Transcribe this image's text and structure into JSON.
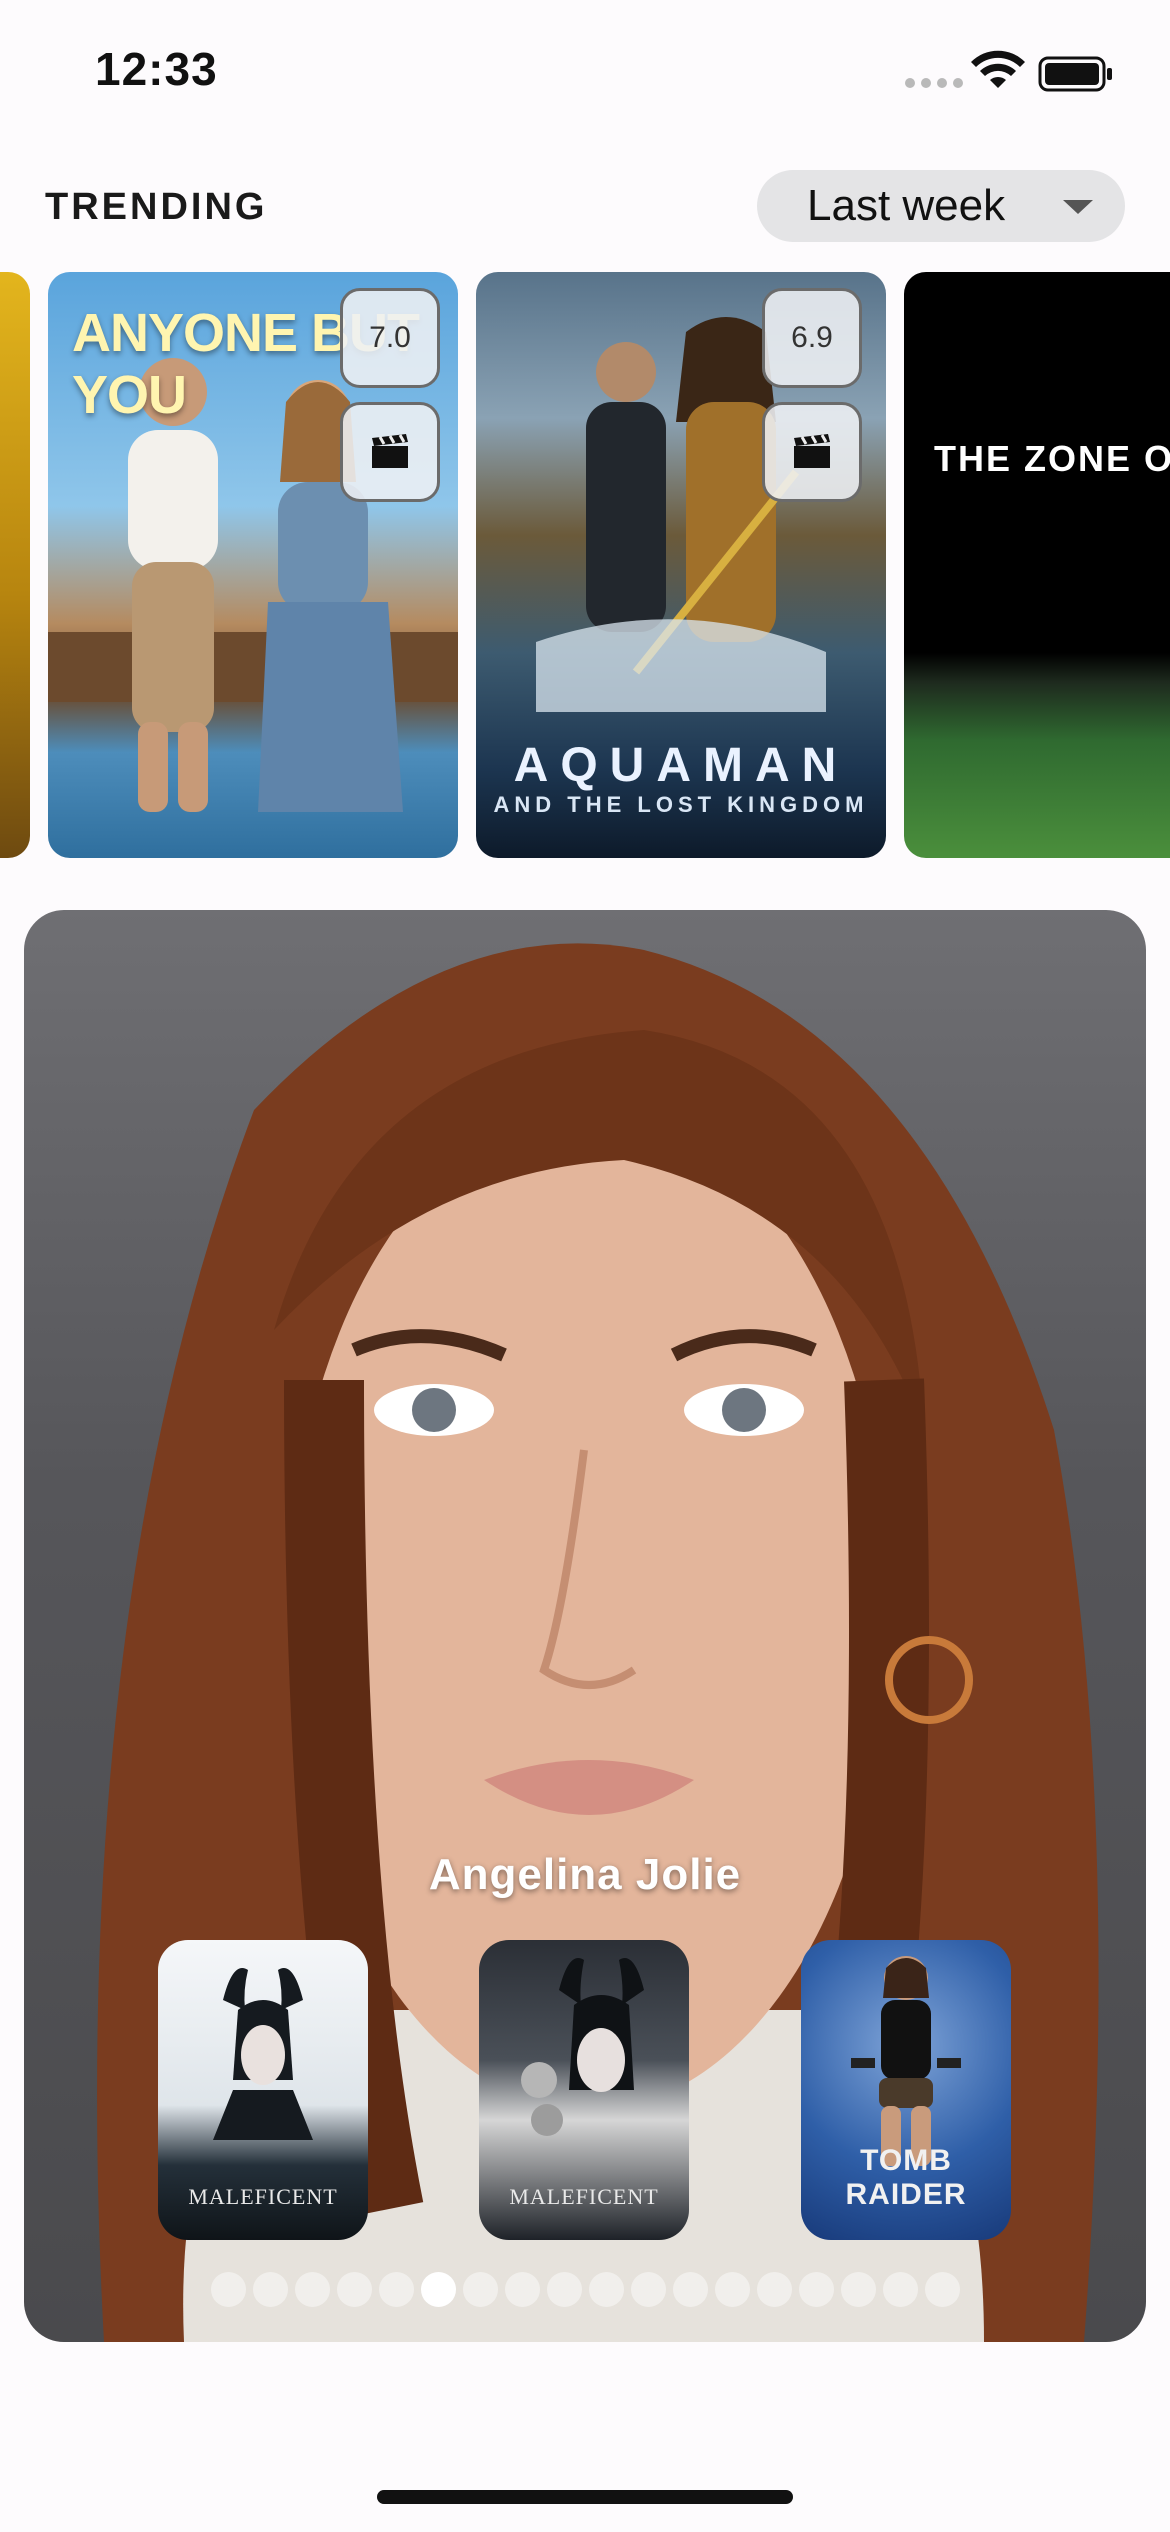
{
  "status_bar": {
    "time": "12:33"
  },
  "trending": {
    "title": "TRENDING",
    "period_selected": "Last week"
  },
  "carousel": [
    {
      "title_text": "ANYONE BUT YOU",
      "rating": "7.0",
      "type_icon": "clapperboard-icon"
    },
    {
      "title_text": "AQUAMAN",
      "subtitle_text": "AND THE LOST KINGDOM",
      "rating": "6.9",
      "type_icon": "clapperboard-icon"
    },
    {
      "title_text": "THE ZONE OF IN"
    }
  ],
  "person": {
    "name": "Angelina Jolie",
    "known_for": [
      {
        "title_text": "MALEFICENT"
      },
      {
        "title_text": "MALEFICENT"
      },
      {
        "title_text": "TOMB RAIDER"
      }
    ],
    "pager": {
      "count": 18,
      "active_index": 5
    }
  }
}
